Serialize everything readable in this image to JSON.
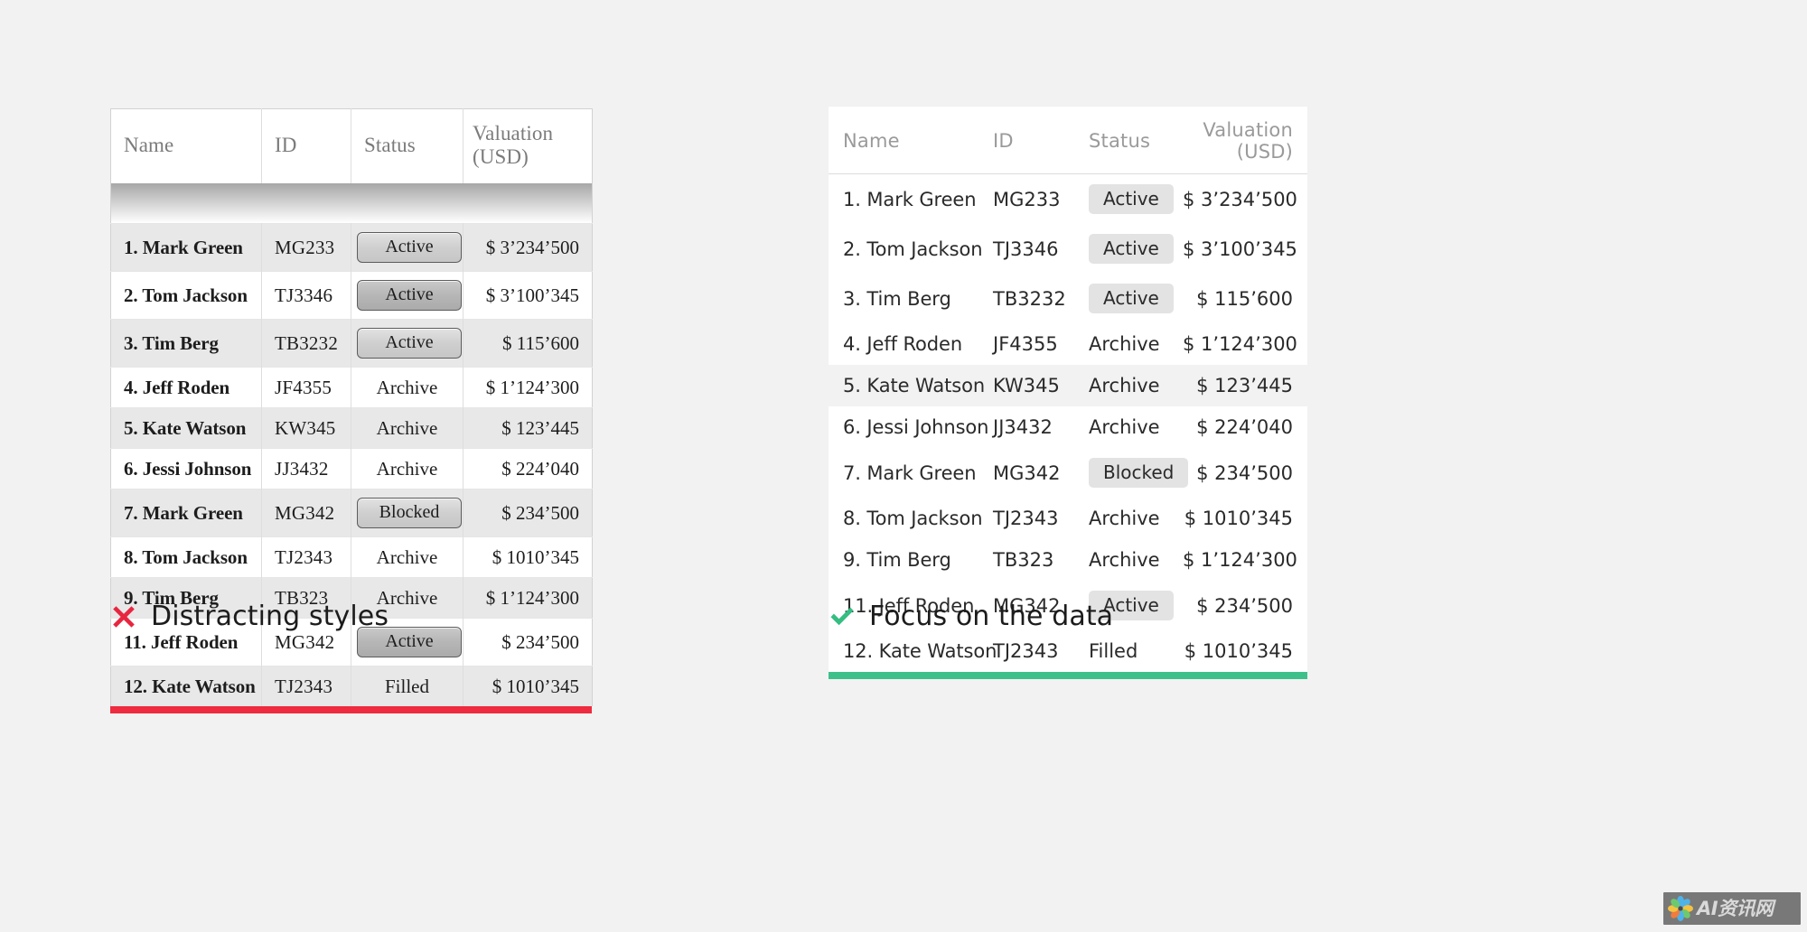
{
  "background_color": "#f2f2f2",
  "columns": [
    "Name",
    "ID",
    "Status",
    "Valuation (USD)"
  ],
  "rows": [
    {
      "name": "1. Mark Green",
      "id": "MG233",
      "status": "Active",
      "valuation": "$ 3’234’500"
    },
    {
      "name": "2. Tom Jackson",
      "id": "TJ3346",
      "status": "Active",
      "valuation": "$ 3’100’345"
    },
    {
      "name": "3. Tim Berg",
      "id": "TB3232",
      "status": "Active",
      "valuation": "$ 115’600"
    },
    {
      "name": "4. Jeff Roden",
      "id": "JF4355",
      "status": "Archive",
      "valuation": "$ 1’124’300"
    },
    {
      "name": "5. Kate Watson",
      "id": "KW345",
      "status": "Archive",
      "valuation": "$ 123’445"
    },
    {
      "name": "6. Jessi Johnson",
      "id": "JJ3432",
      "status": "Archive",
      "valuation": "$ 224’040"
    },
    {
      "name": "7. Mark Green",
      "id": "MG342",
      "status": "Blocked",
      "valuation": "$ 234’500"
    },
    {
      "name": "8. Tom Jackson",
      "id": "TJ2343",
      "status": "Archive",
      "valuation": "$ 1010’345"
    },
    {
      "name": "9. Tim Berg",
      "id": "TB323",
      "status": "Archive",
      "valuation": "$ 1’124’300"
    },
    {
      "name": "11. Jeff Roden",
      "id": "MG342",
      "status": "Active",
      "valuation": "$ 234’500"
    },
    {
      "name": "12. Kate Watson",
      "id": "TJ2343",
      "status": "Filled",
      "valuation": "$ 1010’345"
    }
  ],
  "badged_statuses": [
    "Active",
    "Blocked"
  ],
  "left_panel": {
    "name": "distracting-styles-table",
    "rule_color": "#ee2b3f",
    "caption": "Distracting styles",
    "caption_icon": "cross-icon",
    "caption_icon_color": "#e8253f"
  },
  "right_panel": {
    "name": "focus-on-data-table",
    "rule_color": "#3ec08a",
    "caption": "Focus on the data",
    "caption_icon": "check-icon",
    "caption_icon_color": "#35bd82",
    "highlighted_row_index": 4,
    "badge_background": "#e3e3e3"
  },
  "watermark": {
    "text": "AI资讯网",
    "logo_icon": "flower-logo-icon"
  }
}
